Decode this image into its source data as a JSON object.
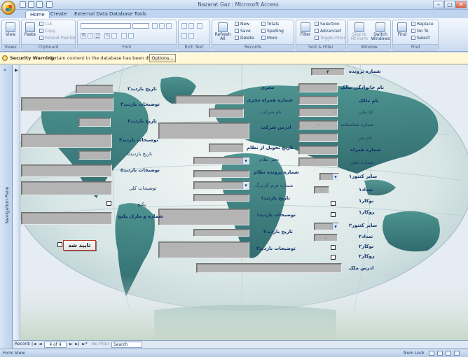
{
  "window": {
    "title": "Nazarat Gaz : Microsoft Access",
    "min": "–",
    "max": "□",
    "close": "✕"
  },
  "tabs": [
    "Home",
    "Create",
    "External Data",
    "Database Tools"
  ],
  "ribbon": {
    "groups": {
      "views": "Views",
      "clipboard": "Clipboard",
      "font": "Font",
      "rich_text": "Rich Text",
      "records": "Records",
      "sort_filter": "Sort & Filter",
      "window": "Window",
      "find": "Find"
    },
    "view": "View",
    "paste": "Paste",
    "cut": "Cut",
    "copy": "Copy",
    "format_painter": "Format Painter",
    "refresh": "Refresh All",
    "new": "New",
    "save": "Save",
    "delete": "Delete",
    "totals": "Totals",
    "spelling": "Spelling",
    "more": "More",
    "filter": "Filter",
    "selection": "Selection",
    "advanced": "Advanced",
    "toggle_filter": "Toggle Filter",
    "size_fit": "Size to Fit Form",
    "switch_windows": "Switch Windows",
    "find": "Find",
    "replace": "Replace",
    "goto": "Go To",
    "select": "Select"
  },
  "security": {
    "title": "Security Warning",
    "message": "Certain content in the database has been disabled",
    "options": "Options..."
  },
  "nav_pane": {
    "label": "Navigation Pane",
    "arrow": "»"
  },
  "form": {
    "case_number_label": "شماره پرونده",
    "case_number_value": "۴",
    "fields_right": {
      "owner_family": "نام خانوادگی مالک",
      "owner_name": "نام مالک",
      "national_code": "کد ملی",
      "id_number": "شماره شناسنامه",
      "father_name": "نام پدر",
      "mobile": "شماره همراه",
      "phone": "شماره تلفن",
      "meter_size1": "سایز کنتور۱",
      "count1": "تعداد۱",
      "kupler1": "نوکار۱",
      "rokar1": "روکار۱",
      "meter_size2": "سایز کنتور۲",
      "count2": "تعداد۲",
      "kupler2": "نوکار۲",
      "rokar2": "روکار۲",
      "address": "ادرس ملک"
    },
    "count1_value": "۰",
    "count2_value": "۰",
    "national_code_value": "۰",
    "id_number_value": "۰",
    "fields_mid": {
      "executor": "مجری",
      "executor_mobile": "شماره همراه مجری",
      "company_name": "نام شرکت",
      "company_address": "ادرس شرکت",
      "delivery_date": "تاریخ تحویل از نظام",
      "system_office": "دفتر نظام",
      "system_file": "شماره پرونده نظام",
      "work_order": "شماره فرم کاربرگ",
      "visit1_date": "تاریخ بازدید۱",
      "visit1_desc": "توضیحات بازدید۱",
      "visit2_date": "تاریخ بازدید۲",
      "visit2_desc": "توضیحات بازدید۲"
    },
    "fields_left": {
      "visit3_date": "تاریخ بازدید۳",
      "visit3_desc": "توضیحات بازدید۳",
      "visit4_date": "تاریخ بازدید۴",
      "visit4_desc": "توضیحات بازدید۴",
      "visit5_date": "تاریخ بازدید۵",
      "visit5_desc": "توضیحات بازدید۵",
      "general_desc": "توضیحات کلی",
      "package": "پکیج",
      "package_brand": "شماره و مارک پکیج"
    },
    "confirm_button": "تایید شد"
  },
  "record_nav": {
    "record_label": "Record:",
    "first": "|◄",
    "prev": "◄",
    "current": "4 of 4",
    "next": "►",
    "last": "►|",
    "new": "►*",
    "filter_status": "No Filter",
    "search": "Search"
  },
  "status": {
    "view": "Form View",
    "num_lock": "Num Lock"
  },
  "colors": {
    "field_gray": "#b4b4b4",
    "label_blue": "#12316a",
    "ocean": "#d9e7ee",
    "land": "#2f7b7d"
  }
}
